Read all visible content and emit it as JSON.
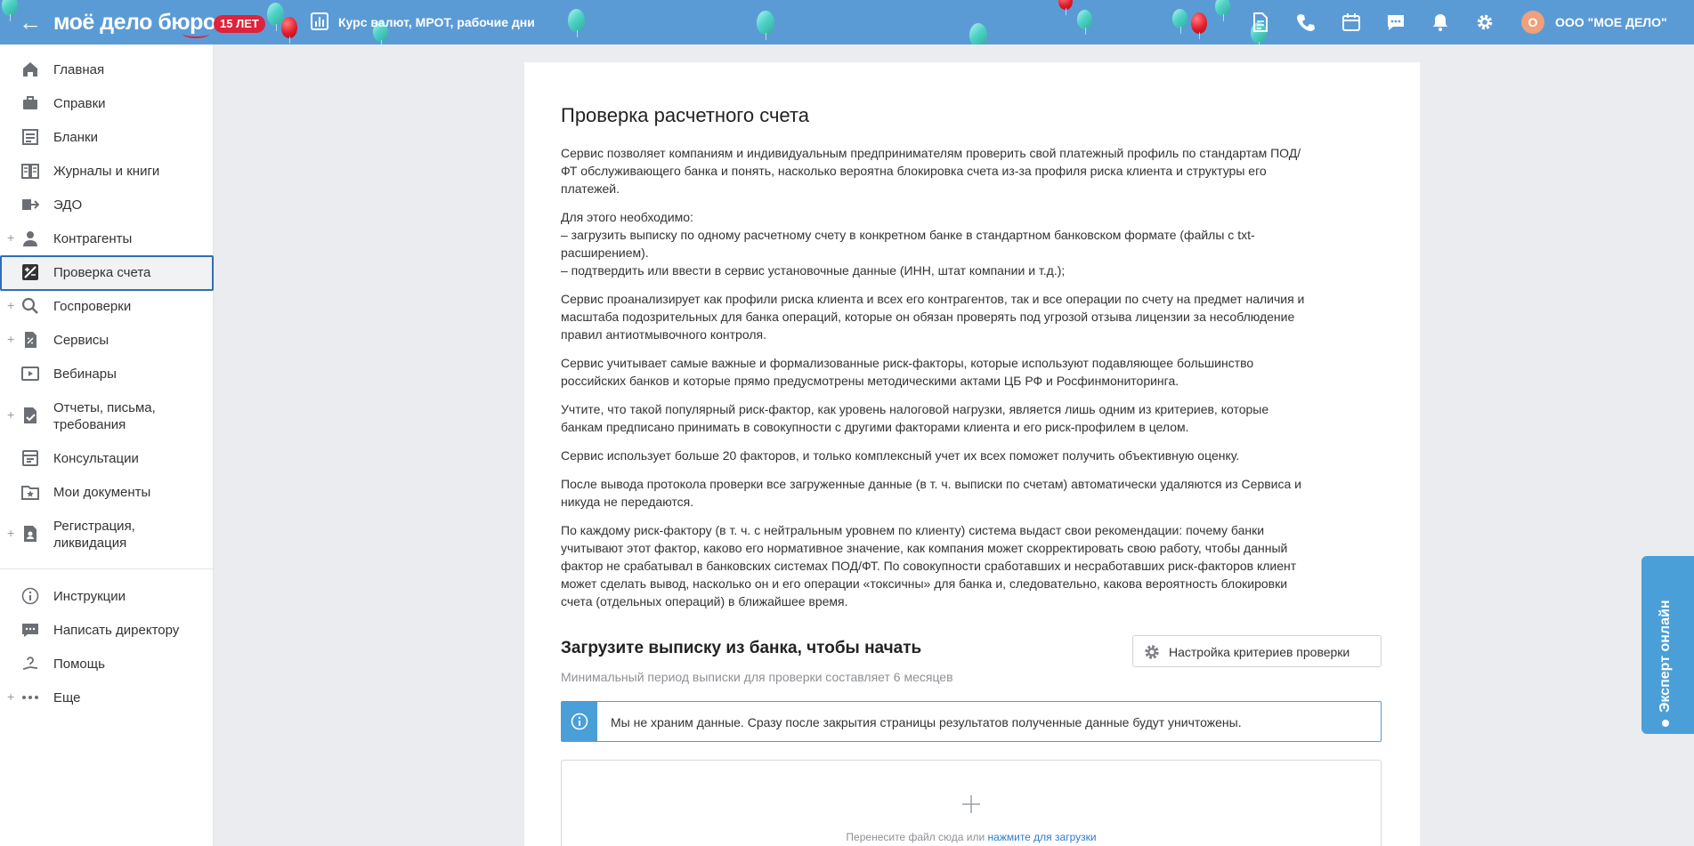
{
  "header": {
    "logo_text": "моё дело бюро",
    "badge": "15 ЛЕТ",
    "rates_link": "Курс валют, МРОТ, рабочие дни",
    "avatar_letter": "О",
    "company_name": "ООО \"МОЕ ДЕЛО\"",
    "icons": [
      "back-arrow-icon",
      "chart-icon",
      "document-icon",
      "phone-icon",
      "calendar-icon",
      "chat-icon",
      "bell-icon",
      "gear-icon"
    ],
    "colors": {
      "bar": "#5b9bd5",
      "badge": "#e0223b",
      "avatar": "#f0a07a"
    }
  },
  "sidebar": {
    "items": [
      {
        "label": "Главная",
        "icon": "home-icon",
        "has_plus": false
      },
      {
        "label": "Справки",
        "icon": "briefcase-icon",
        "has_plus": false
      },
      {
        "label": "Бланки",
        "icon": "forms-icon",
        "has_plus": false
      },
      {
        "label": "Журналы и книги",
        "icon": "book-icon",
        "has_plus": false
      },
      {
        "label": "ЭДО",
        "icon": "edo-icon",
        "has_plus": false
      },
      {
        "label": "Контрагенты",
        "icon": "contractors-icon",
        "has_plus": true
      },
      {
        "label": "Проверка счета",
        "icon": "account-check-icon",
        "has_plus": false,
        "active": true
      },
      {
        "label": "Госпроверки",
        "icon": "inspection-icon",
        "has_plus": true
      },
      {
        "label": "Сервисы",
        "icon": "services-icon",
        "has_plus": true
      },
      {
        "label": "Вебинары",
        "icon": "webinar-icon",
        "has_plus": false
      },
      {
        "label": "Отчеты, письма, требования",
        "icon": "reports-icon",
        "has_plus": true
      },
      {
        "label": "Консультации",
        "icon": "consultation-icon",
        "has_plus": false
      },
      {
        "label": "Мои документы",
        "icon": "my-documents-icon",
        "has_plus": false
      },
      {
        "label": "Регистрация, ликвидация",
        "icon": "registration-icon",
        "has_plus": true
      }
    ],
    "bottom_items": [
      {
        "label": "Инструкции",
        "icon": "info-icon",
        "has_plus": false
      },
      {
        "label": "Написать директору",
        "icon": "message-icon",
        "has_plus": false
      },
      {
        "label": "Помощь",
        "icon": "help-icon",
        "has_plus": false
      },
      {
        "label": "Еще",
        "icon": "more-icon",
        "has_plus": true
      }
    ],
    "active_color": "#2f6eb8"
  },
  "main": {
    "title": "Проверка расчетного счета",
    "paragraphs": [
      [
        "Сервис позволяет компаниям и индивидуальным предпринимателям проверить свой платежный профиль по стандартам ПОД/",
        "ФТ обслуживающего банка и понять, насколько вероятна блокировка счета из-за профиля риска клиента и структуры его",
        "платежей."
      ],
      [
        "Для этого необходимо:",
        "– загрузить выписку по одному расчетному счету в конкретном банке в стандартном банковском формате (файлы с txt-",
        "расширением).",
        "– подтвердить или ввести в сервис установочные данные (ИНН, штат компании и т.д.);"
      ],
      [
        "Сервис проанализирует как профили риска клиента и всех его контрагентов, так и все операции по счету на предмет наличия и",
        "масштаба подозрительных для банка операций, которые он обязан проверять под угрозой отзыва лицензии за несоблюдение",
        "правил антиотмывочного контроля."
      ],
      [
        "Сервис учитывает самые важные и формализованные риск-факторы, которые используют подавляющее большинство",
        "российских банков и которые прямо предусмотрены методическими актами ЦБ РФ и Росфинмониторинга."
      ],
      [
        "Учтите, что такой популярный риск-фактор, как уровень налоговой нагрузки, является лишь одним из критериев, которые",
        "банкам предписано принимать в совокупности с другими факторами клиента и его риск-профилем в целом."
      ],
      [
        "Сервис использует больше 20 факторов, и только комплексный учет их всех поможет получить объективную оценку."
      ],
      [
        "После вывода протокола проверки все загруженные данные (в т. ч. выписки по счетам) автоматически удаляются из Сервиса и",
        "никуда не передаются."
      ],
      [
        "По каждому риск-фактору (в т. ч. с нейтральным уровнем по клиенту) система выдаст свои рекомендации: почему банки",
        "учитывают этот фактор, каково его нормативное значение, как компания может скорректировать свою работу, чтобы данный",
        "фактор не срабатывал в банковских системах ПОД/ФТ. По совокупности сработавших и несработавших риск-факторов клиент",
        "может сделать вывод, насколько он и его операции «токсичны» для банка и, следовательно, какова вероятность блокировки",
        "счета (отдельных операций) в ближайшее время."
      ]
    ],
    "upload_heading": "Загрузите выписку из банка, чтобы начать",
    "upload_note": "Минимальный период выписки для проверки составляет 6 месяцев",
    "settings_button": "Настройка критериев проверки",
    "info_text": "Мы не храним данные. Сразу после закрытия страницы результатов полученные данные будут уничтожены.",
    "dropzone_text": "Перенесите файл сюда или",
    "dropzone_link": "нажмите для загрузки",
    "accent_color": "#4a9fd9"
  },
  "expert_tab": {
    "label": "Эксперт онлайн"
  }
}
